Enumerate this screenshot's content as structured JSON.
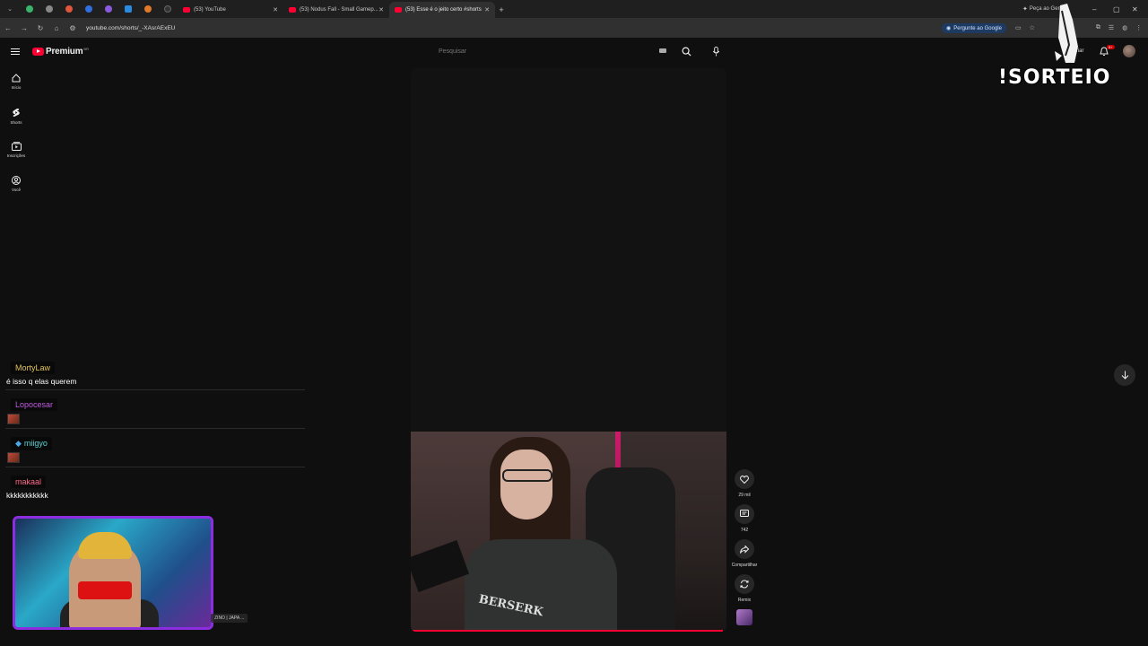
{
  "browser": {
    "tabs": [
      {
        "title": "(53) YouTube",
        "active": false
      },
      {
        "title": "(53) Nodus Fall - Small Gamep...",
        "active": false
      },
      {
        "title": "(53) Esse é o jeito certo #shorts",
        "active": true
      }
    ],
    "url": "youtube.com/shorts/_-XAsrAExEU",
    "gemini_button": "Pergunte ao Google",
    "gemini_tab_pill": "Peça ao Gemini",
    "new_tab": "+"
  },
  "youtube": {
    "logo_text": "Premium",
    "logo_sup": "BR",
    "search_placeholder": "Pesquisar",
    "notifications_badge": "9+",
    "create_label": "Criar",
    "guide": [
      {
        "label": "Início",
        "icon": "home-icon"
      },
      {
        "label": "Shorts",
        "icon": "shorts-icon"
      },
      {
        "label": "Inscrições",
        "icon": "subscriptions-icon"
      },
      {
        "label": "Você",
        "icon": "you-icon"
      }
    ],
    "short": {
      "shirt_text": "BERSERK",
      "likes": "29 mil",
      "comments": "742",
      "share": "Compartilhar",
      "remix": "Remix"
    }
  },
  "overlay": {
    "sorteio_text": "!SORTEIO",
    "chat": [
      {
        "name": "MortyLaw",
        "name_color": "#e0c25a",
        "message": "é isso q elas querem",
        "emote": false
      },
      {
        "name": "Lopocesar",
        "name_color": "#c05be0",
        "message": "",
        "emote": true
      },
      {
        "name": "miigyo",
        "name_color": "#5ad6d6",
        "message": "",
        "emote": true,
        "badge": true
      },
      {
        "name": "makaal",
        "name_color": "#ff6a8a",
        "message": "kkkkkkkkkkk",
        "emote": false
      }
    ],
    "webcam_label": "ZINO | JAPA ..."
  },
  "colors": {
    "accent": "#ff0033",
    "webcam_border": "#8c2de0"
  }
}
